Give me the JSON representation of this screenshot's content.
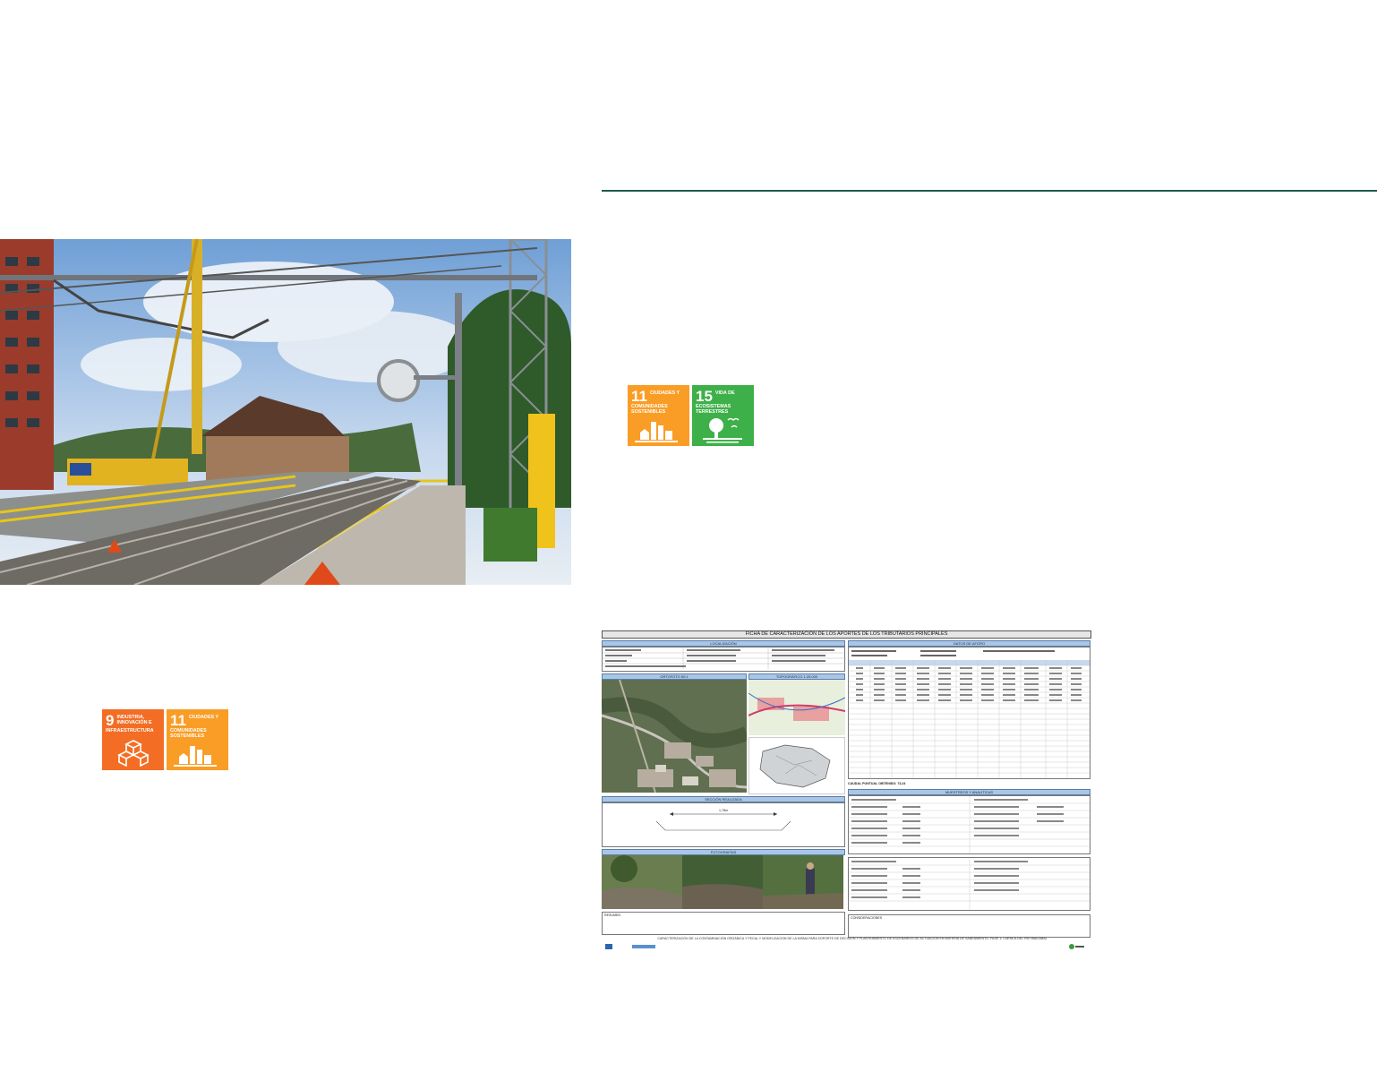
{
  "sdg_top": [
    {
      "number": "11",
      "title": "Ciudades y comunidades sostenibles",
      "color": "#f99d26",
      "icon": "city-icon"
    },
    {
      "number": "15",
      "title": "Vida de ecosistemas terrestres",
      "color": "#3eb049",
      "icon": "tree-icon"
    }
  ],
  "sdg_bottom": [
    {
      "number": "9",
      "title": "Industria, innovación e infraestructura",
      "color": "#f36d25",
      "icon": "cubes-icon"
    },
    {
      "number": "11",
      "title": "Ciudades y comunidades sostenibles",
      "color": "#f99d26",
      "icon": "city-icon"
    }
  ],
  "sheet": {
    "title": "FICHA DE CARACTERIZACIÓN DE LOS APORTES DE LOS TRIBUTARIOS PRINCIPALES",
    "sections": {
      "localizacion": "LOCALIZACIÓN",
      "datos_aforo": "DATOS DE AFORO",
      "ortofoto": "ORTOFOTO 50:1",
      "topografico": "TOPOGRÁFICO 1:25.000",
      "seccion": "SECCIÓN REALIZADA",
      "fotografias": "FOTOGRAFÍAS",
      "muestreos": "MUESTREOS Y ANALÍTICAS",
      "resumen": "RESUMEN",
      "consideraciones": "CONSIDERACIONES"
    },
    "caudal": "CAUDAL PUNTUAL OBTENIDO: 73,24",
    "section_width": "1,78m",
    "footer": "CARACTERIZACIÓN DE LA CONTAMINACIÓN ORGÁNICA Y FECAL Y MODELIZACIÓN DE LA MISMA PARA SOPORTE DE DECISIÓN Y PLANTEAMIENTO DE ESCENARIOS DE ACTUACIÓN EN MATERIA DE SANEAMIENTO. FASE 1: CUENCA DEL RÍO IBAIZABAL"
  }
}
